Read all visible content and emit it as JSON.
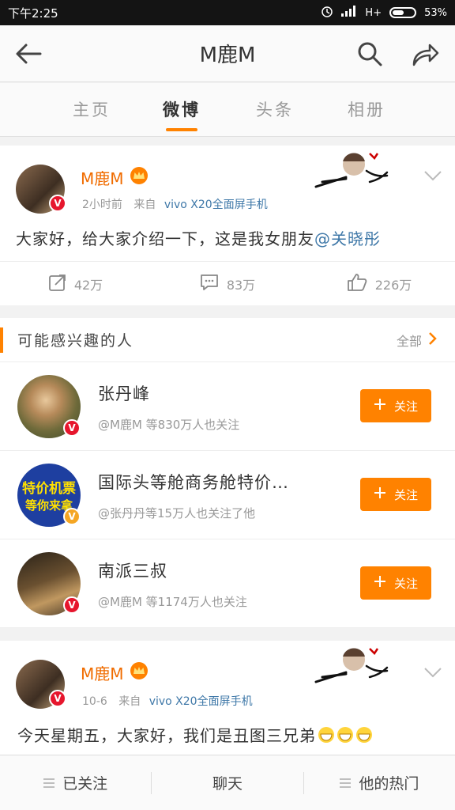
{
  "status_bar": {
    "time": "下午2:25",
    "network": "H+",
    "battery": "53%"
  },
  "header": {
    "title": "M鹿M"
  },
  "tabs": [
    {
      "label": "主页"
    },
    {
      "label": "微博"
    },
    {
      "label": "头条"
    },
    {
      "label": "相册"
    }
  ],
  "active_tab": "微博",
  "posts": [
    {
      "username": "M鹿M",
      "time": "2小时前",
      "source_prefix": "来自",
      "source": "vivo X20全面屏手机",
      "text": "大家好，给大家介绍一下，这是我女朋友",
      "mention": "@关晓彤",
      "repost_count": "42万",
      "comment_count": "83万",
      "like_count": "226万"
    },
    {
      "username": "M鹿M",
      "time": "10-6",
      "source_prefix": "来自",
      "source": "vivo X20全面屏手机",
      "text": "今天星期五，大家好，我们是丑图三兄弟"
    }
  ],
  "suggestions": {
    "title": "可能感兴趣的人",
    "all_label": "全部",
    "follow_label": "关注",
    "items": [
      {
        "name": "张丹峰",
        "desc": "@M鹿M 等830万人也关注",
        "badge": "red"
      },
      {
        "name": "国际头等舱商务舱特价…",
        "desc": "@张丹丹等15万人也关注了他",
        "badge": "gold",
        "avatar_text_1": "特价机票",
        "avatar_text_2": "等你来拿"
      },
      {
        "name": "南派三叔",
        "desc": "@M鹿M 等1174万人也关注",
        "badge": "red"
      }
    ]
  },
  "bottom_bar": [
    {
      "label": "已关注"
    },
    {
      "label": "聊天"
    },
    {
      "label": "他的热门"
    }
  ],
  "colors": {
    "accent": "#ff8200",
    "username": "#f06c00",
    "link": "#3f78a8",
    "vip_badge": "#f5a623",
    "verified_badge": "#e6162d"
  },
  "icons": [
    "back-arrow-icon",
    "search-icon",
    "share-icon",
    "chevron-down-icon",
    "repost-icon",
    "comment-icon",
    "like-icon",
    "plus-icon",
    "menu-icon",
    "crown-icon"
  ]
}
